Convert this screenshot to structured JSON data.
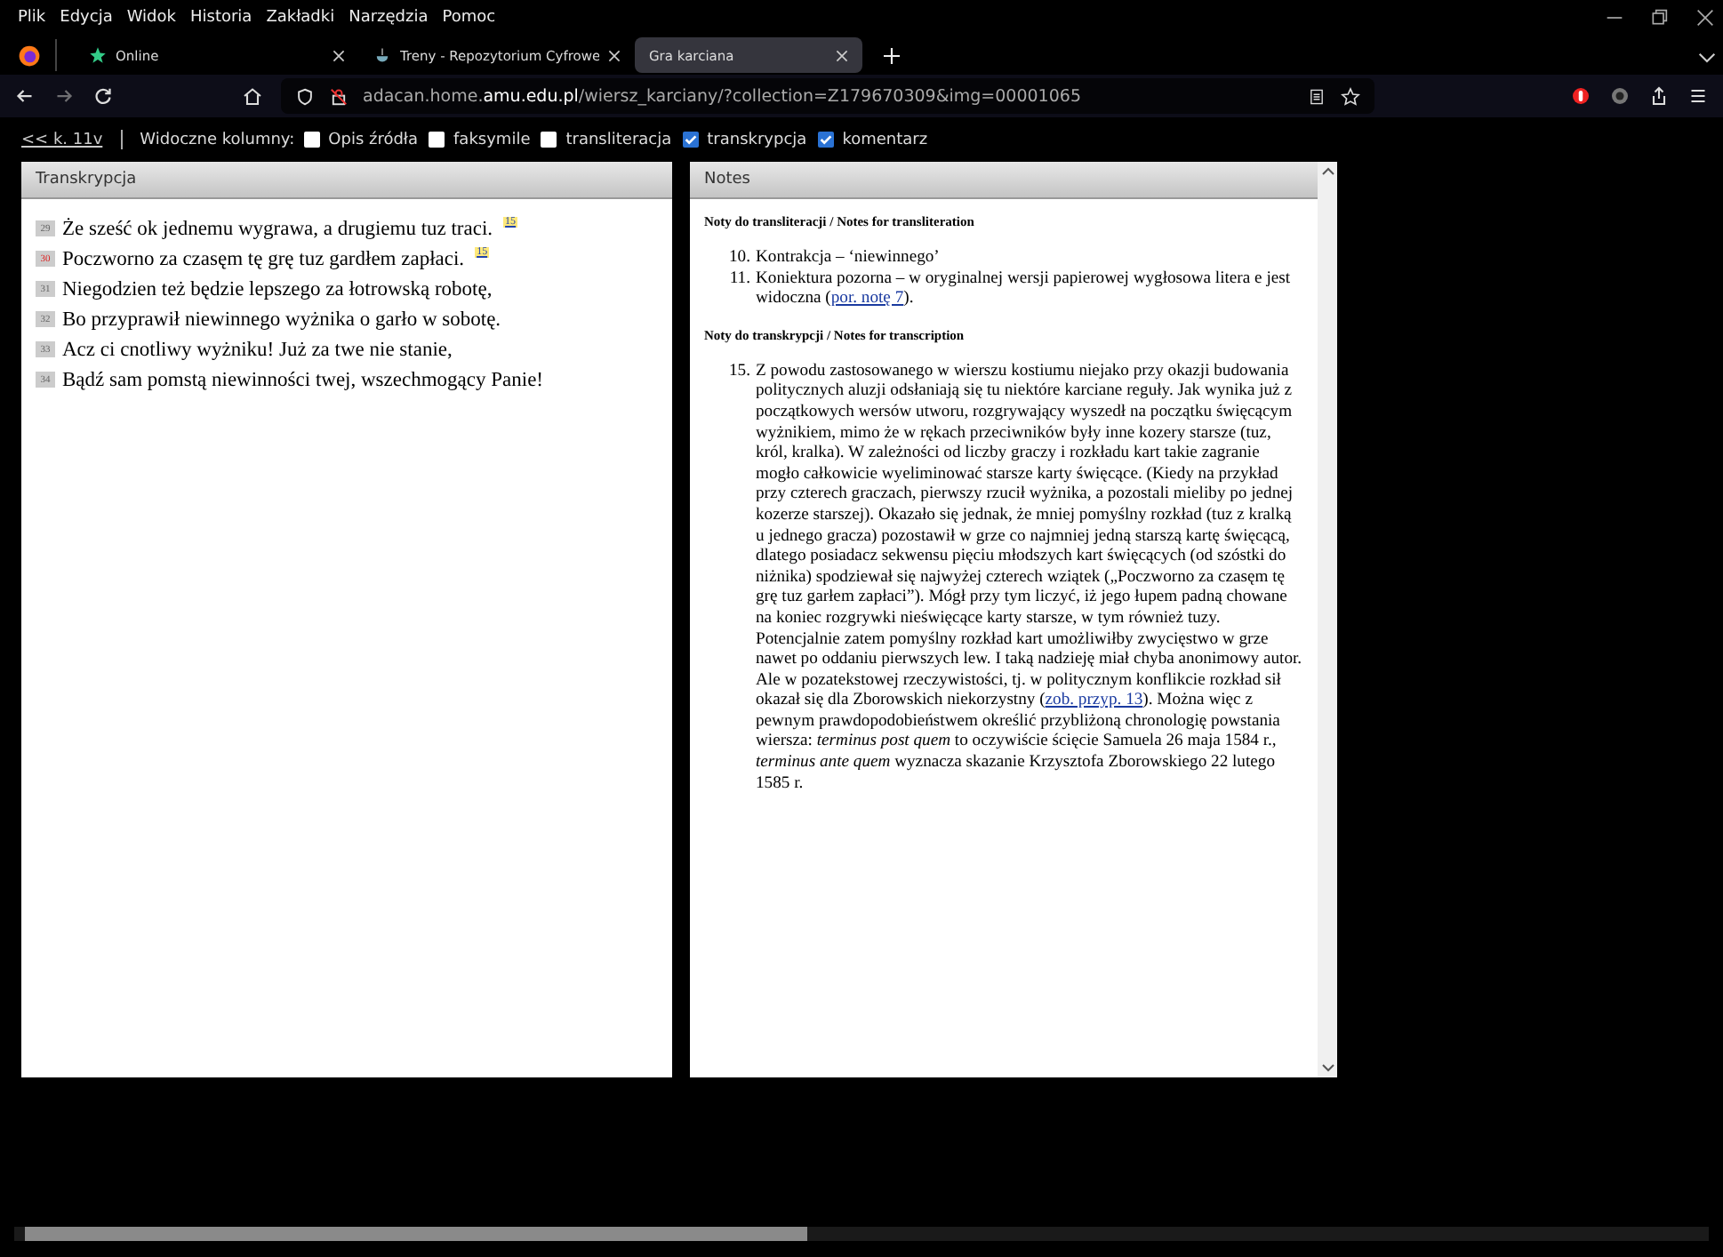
{
  "menu_bar": [
    "Plik",
    "Edycja",
    "Widok",
    "Historia",
    "Zakładki",
    "Narzędzia",
    "Pomoc"
  ],
  "tabs": [
    {
      "label": "Online",
      "selected": false
    },
    {
      "label": "Treny - Repozytorium Cyfrowe",
      "selected": false
    },
    {
      "label": "Gra karciana",
      "selected": true
    }
  ],
  "address_bar": {
    "value": "adacan.home.**amu.edu.pl**/wiersz_karciany/?collection=Z179670309&img=00001065"
  },
  "options": {
    "back_link": "<< k. 11v",
    "label": "Widoczne kolumny:",
    "columns": [
      {
        "label": "Opis źródła",
        "checked": false
      },
      {
        "label": "faksymile",
        "checked": false
      },
      {
        "label": "transliteracja",
        "checked": false
      },
      {
        "label": "transkrypcja",
        "checked": true
      },
      {
        "label": "komentarz",
        "checked": true
      }
    ]
  },
  "transcription": {
    "title": "Transkrypcja",
    "lines": [
      {
        "number": "29",
        "text": "Że sześć ok jednemu wygrawa, a drugiemu tuz traci.",
        "current": false,
        "note": "15"
      },
      {
        "number": "30",
        "text": "Poczworno za czasęm tę grę tuz gardłem zapłaci.",
        "current": true,
        "note": "15"
      },
      {
        "number": "31",
        "text": "Niegodzien też będzie lepszego za łotrowską robotę,",
        "current": false
      },
      {
        "number": "32",
        "text": "Bo przyprawił niewinnego wyżnika o garło w sobotę.",
        "current": false
      },
      {
        "number": "33",
        "text": "Acz ci cnotliwy wyżniku! Już za twe nie stanie,",
        "current": false
      },
      {
        "number": "34",
        "text": "Bądź sam pomstą niewinności twej, wszechmogący Panie!",
        "current": false
      }
    ]
  },
  "notes": {
    "title": "Notes",
    "sections": [
      {
        "heading": "Noty do transliteracji / Notes for transliteration",
        "items": [
          {
            "number": "10.",
            "parts": [
              {
                "kind": "text",
                "text": "Kontrakcja – ‘niewinnego’"
              }
            ]
          },
          {
            "number": "11.",
            "parts": [
              {
                "kind": "text",
                "text": "Koniektura pozorna – w oryginalnej wersji papierowej wygłosowa litera e jest widoczna ("
              },
              {
                "kind": "link",
                "text": "por. notę 7"
              },
              {
                "kind": "text",
                "text": ")."
              }
            ]
          }
        ]
      },
      {
        "heading": "Noty do transkrypcji / Notes for transcription",
        "items": [
          {
            "number": "15.",
            "parts": [
              {
                "kind": "text",
                "text": "Z powodu zastosowanego w wierszu kostiumu niejako przy okazji budowania politycznych aluzji odsłaniają się tu niektóre karciane reguły. Jak wynika już z początkowych wersów utworu, rozgrywający wyszedł na początku święcącym wyżnikiem, mimo że w rękach przeciwników były inne kozery starsze (tuz, król, kralka). W zależności od liczby graczy i rozkładu kart takie zagranie mogło całkowicie wyeliminować starsze karty święcące. (Kiedy na przykład przy czterech graczach, pierwszy rzucił wyżnika, a pozostali mieliby po jednej kozerze starszej). Okazało się jednak, że mniej pomyślny rozkład (tuz z kralką u jednego gracza) pozostawił w grze co najmniej jedną starszą kartę święcącą, dlatego posiadacz sekwensu pięciu młodszych kart święcących (od szóstki do niżnika) spodziewał się najwyżej czterech wziątek („Poczworno za czasęm tę grę tuz garłem zapłaci”). Mógł przy tym liczyć, iż jego łupem padną chowane na koniec rozgrywki nieświęcące karty starsze, w tym również tuzy. Potencjalnie zatem pomyślny rozkład kart umożliwiłby zwycięstwo w grze nawet po oddaniu pierwszych lew. I taką nadzieję miał chyba anonimowy autor. Ale w pozatekstowej rzeczywistości, tj. w politycznym konflikcie rozkład sił okazał się dla Zborowskich niekorzystny ("
              },
              {
                "kind": "link",
                "text": "zob. przyp. 13"
              },
              {
                "kind": "text",
                "text": "). Można więc z pewnym prawdopodobieństwem określić przybliżoną chronologię powstania wiersza: *terminus post quem* to oczywiście ścięcie Samuela 26 maja 1584 r., *terminus ante quem* wyznacza skazanie Krzysztofa Zborowskiego 22 lutego 1585 r."
              }
            ]
          }
        ]
      }
    ]
  }
}
